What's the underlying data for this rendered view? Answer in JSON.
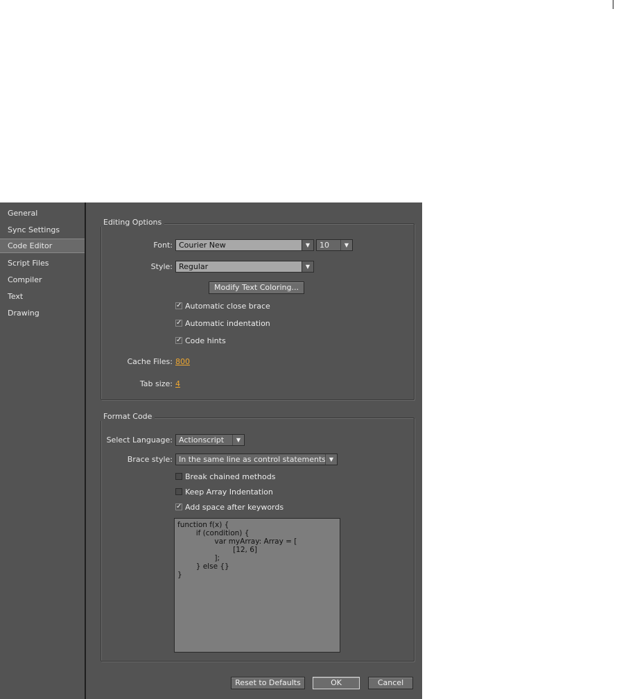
{
  "sidebar": {
    "items": [
      {
        "label": "General"
      },
      {
        "label": "Sync Settings"
      },
      {
        "label": "Code Editor",
        "selected": true
      },
      {
        "label": "Script Files"
      },
      {
        "label": "Compiler"
      },
      {
        "label": "Text"
      },
      {
        "label": "Drawing"
      }
    ]
  },
  "editing_options": {
    "title": "Editing Options",
    "font_label": "Font:",
    "font_value": "Courier New",
    "size_value": "10",
    "style_label": "Style:",
    "style_value": "Regular",
    "modify_button": "Modify Text Coloring...",
    "auto_close_brace": {
      "label": "Automatic close brace",
      "checked": true
    },
    "auto_indentation": {
      "label": "Automatic indentation",
      "checked": true
    },
    "code_hints": {
      "label": "Code hints",
      "checked": true
    },
    "cache_label": "Cache Files:",
    "cache_value": "800",
    "tab_label": "Tab size:",
    "tab_value": "4"
  },
  "format_code": {
    "title": "Format Code",
    "language_label": "Select Language:",
    "language_value": "Actionscript",
    "brace_label": "Brace style:",
    "brace_value": "In the same line as control statements",
    "break_chained": {
      "label": "Break chained methods",
      "checked": false
    },
    "keep_array": {
      "label": "Keep Array Indentation",
      "checked": false
    },
    "add_space": {
      "label": "Add space after keywords",
      "checked": true
    },
    "preview_lines": [
      "function f(x) {",
      "        if (condition) {",
      "                var myArray: Array = [",
      "                        [12, 6]",
      "                ];",
      "        } else {}",
      "}"
    ]
  },
  "footer": {
    "reset_button": "Reset to Defaults",
    "ok_button": "OK",
    "cancel_button": "Cancel"
  },
  "icons": {
    "dropdown": "chevron-down-icon",
    "checkmark": "checkmark-icon"
  }
}
